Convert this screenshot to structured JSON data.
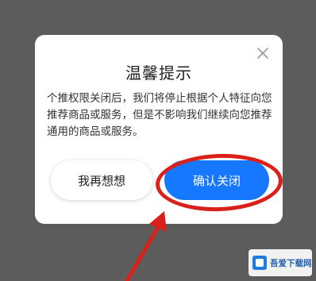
{
  "dialog": {
    "title": "温馨提示",
    "message": "个推权限关闭后，我们将停止根据个人特征向您推荐商品或服务，但是不影响我们继续向您推荐通用的商品或服务。",
    "close_icon": "close-icon",
    "secondary_label": "我再想想",
    "primary_label": "确认关闭",
    "primary_color": "#1677ff"
  },
  "annotation": {
    "color": "#d9201a"
  },
  "watermark": {
    "text": "吾爱下载网"
  }
}
